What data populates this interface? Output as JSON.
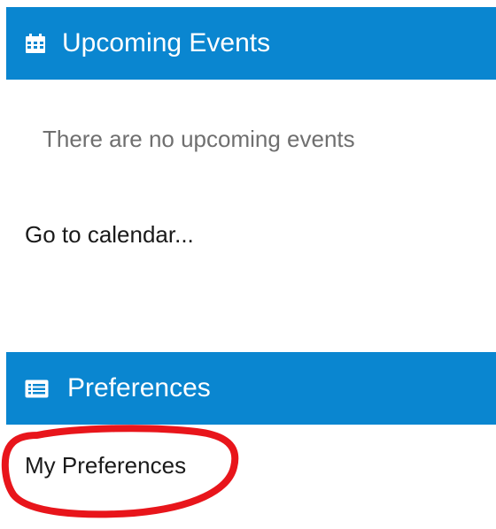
{
  "upcoming_events": {
    "title": "Upcoming Events",
    "icon": "calendar-icon",
    "empty_message": "There are no upcoming events",
    "calendar_link": "Go to calendar..."
  },
  "preferences": {
    "title": "Preferences",
    "icon": "list-icon",
    "my_preferences_link": "My Preferences"
  },
  "colors": {
    "header_background": "#0a86d0",
    "header_text": "#ffffff",
    "annotation": "#e8151b"
  }
}
